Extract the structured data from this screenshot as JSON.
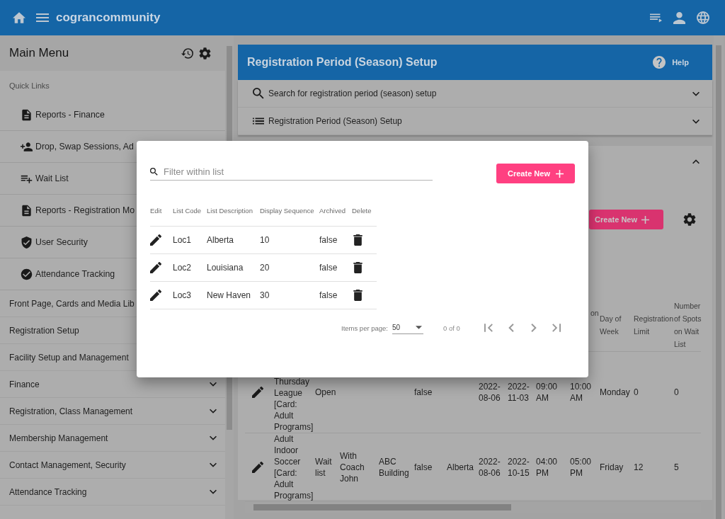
{
  "app_bar": {
    "title": "cograncommunity"
  },
  "sidebar": {
    "title": "Main Menu",
    "quick_links_label": "Quick Links",
    "quick_links": [
      {
        "kind": "document",
        "label": "Reports - Finance"
      },
      {
        "kind": "person-add",
        "label": "Drop, Swap Sessions, Ad"
      },
      {
        "kind": "playlist-add",
        "label": "Wait List"
      },
      {
        "kind": "document",
        "label": "Reports - Registration Mo"
      },
      {
        "kind": "shield",
        "label": "User Security"
      },
      {
        "kind": "check-circle",
        "label": "Attendance Tracking"
      }
    ],
    "sections": [
      {
        "label": "Front Page, Cards and Media Lib",
        "chevron": false
      },
      {
        "label": "Registration Setup",
        "chevron": false
      },
      {
        "label": "Facility Setup and Management",
        "chevron": false
      },
      {
        "label": "Finance",
        "chevron": true
      },
      {
        "label": "Registration, Class Management",
        "chevron": true
      },
      {
        "label": "Membership Management",
        "chevron": true
      },
      {
        "label": "Contact Management, Security",
        "chevron": true
      },
      {
        "label": "Attendance Tracking",
        "chevron": true
      }
    ]
  },
  "page": {
    "title": "Registration Period (Season) Setup",
    "help": "Help",
    "panels": [
      {
        "kind": "search",
        "label": "Search for registration period (season) setup"
      },
      {
        "kind": "list",
        "label": "Registration Period (Season) Setup"
      }
    ],
    "create_button": "Create New",
    "table": {
      "columns": [
        "",
        "",
        "",
        "",
        "",
        "",
        "",
        "",
        "",
        "on",
        "Day of Week",
        "Registration Limit",
        "Number of Spots on Wait List"
      ],
      "rows": [
        {
          "cells": [
            "Thursday League [Card: Adult Programs]",
            "Open",
            "",
            "",
            "false",
            "",
            "2022-08-06",
            "2022-11-03",
            "09:00 AM",
            "10:00 AM",
            "Monday",
            "0",
            "0"
          ]
        },
        {
          "cells": [
            "Adult Indoor Soccer [Card: Adult Programs]",
            "Wait list",
            "With Coach John",
            "ABC Building",
            "false",
            "Alberta",
            "2022-08-06",
            "2022-10-15",
            "04:00 PM",
            "05:00 PM",
            "Friday",
            "12",
            "5"
          ]
        }
      ]
    }
  },
  "dialog": {
    "filter": {
      "placeholder": "Filter within list"
    },
    "create_button": "Create New",
    "columns": [
      "Edit",
      "List Code",
      "List Description",
      "Display Sequence",
      "Archived",
      "Delete"
    ],
    "rows": [
      {
        "code": "Loc1",
        "description": "Alberta",
        "sequence": "10",
        "archived": "false"
      },
      {
        "code": "Loc2",
        "description": "Louisiana",
        "sequence": "20",
        "archived": "false"
      },
      {
        "code": "Loc3",
        "description": "New Haven",
        "sequence": "30",
        "archived": "false"
      }
    ],
    "paginator": {
      "items_per_page_label": "Items per page:",
      "page_size": "50",
      "range": "0 of 0"
    }
  }
}
